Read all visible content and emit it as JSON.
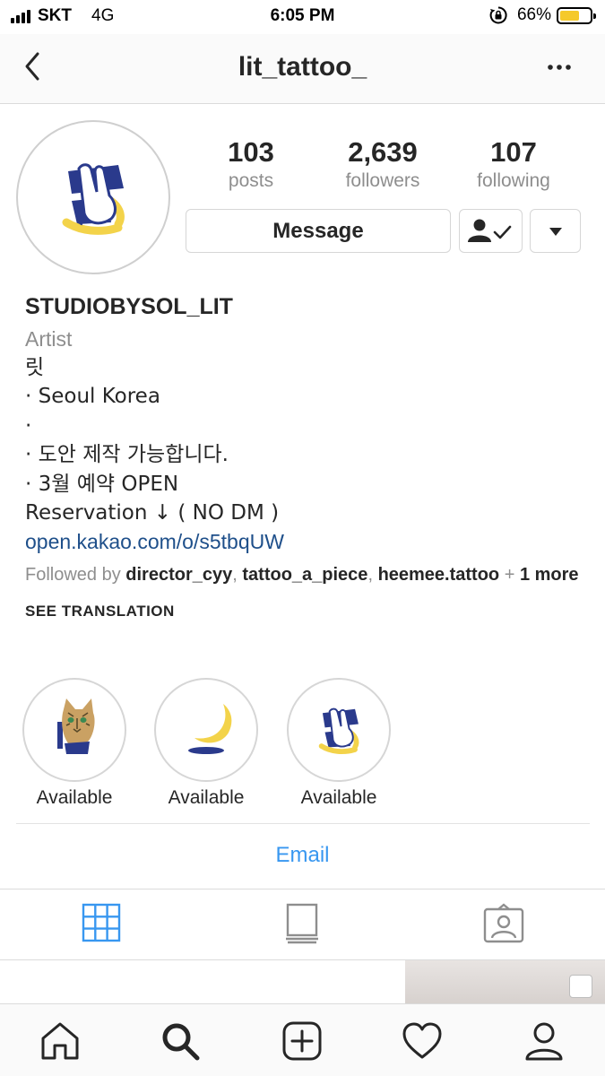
{
  "status_bar": {
    "carrier": "SKT",
    "network": "4G",
    "time": "6:05 PM",
    "battery_text": "66%",
    "battery_level": 0.66,
    "battery_color": "#f5c92b"
  },
  "nav": {
    "title": "lit_tattoo_",
    "back_icon": "chevron-left-icon",
    "more_icon": "more-horizontal-icon"
  },
  "stats": {
    "posts_count": "103",
    "posts_label": "posts",
    "followers_count": "2,639",
    "followers_label": "followers",
    "following_count": "107",
    "following_label": "following"
  },
  "actions": {
    "message_label": "Message",
    "following_icon": "person-check-icon",
    "dropdown_icon": "triangle-down-icon"
  },
  "bio": {
    "name": "STUDIOBYSOL_LIT",
    "category": "Artist",
    "lines": [
      "릿",
      "· Seoul Korea",
      "·",
      "· 도안 제작 가능합니다.",
      "· 3월 예약 OPEN",
      "Reservation ↓ ( NO DM )"
    ],
    "link": "open.kakao.com/o/s5tbqUW",
    "followed_by_prefix": "Followed by ",
    "followed_by_users": [
      "director_cyy",
      "tattoo_a_piece",
      "heemee.tattoo"
    ],
    "followed_by_sep": ", ",
    "followed_by_plus": " + ",
    "followed_by_more": "1 more",
    "see_translation": "SEE TRANSLATION"
  },
  "highlights": [
    {
      "label": "Available",
      "icon": "cat-illustration"
    },
    {
      "label": "Available",
      "icon": "moon-illustration"
    },
    {
      "label": "Available",
      "icon": "crossed-fingers-illustration"
    }
  ],
  "contact": {
    "email_label": "Email"
  },
  "profile_tabs": [
    "grid-icon",
    "feed-icon",
    "tagged-icon"
  ],
  "bottom_nav": [
    "home-icon",
    "search-icon",
    "add-post-icon",
    "heart-icon",
    "profile-icon"
  ],
  "colors": {
    "accent_blue": "#3897f0",
    "link_blue": "#1e4f8a",
    "muted_gray": "#8e8e8e",
    "text_dark": "#262626",
    "logo_navy": "#2a3a8c",
    "logo_yellow": "#f3d34a"
  }
}
